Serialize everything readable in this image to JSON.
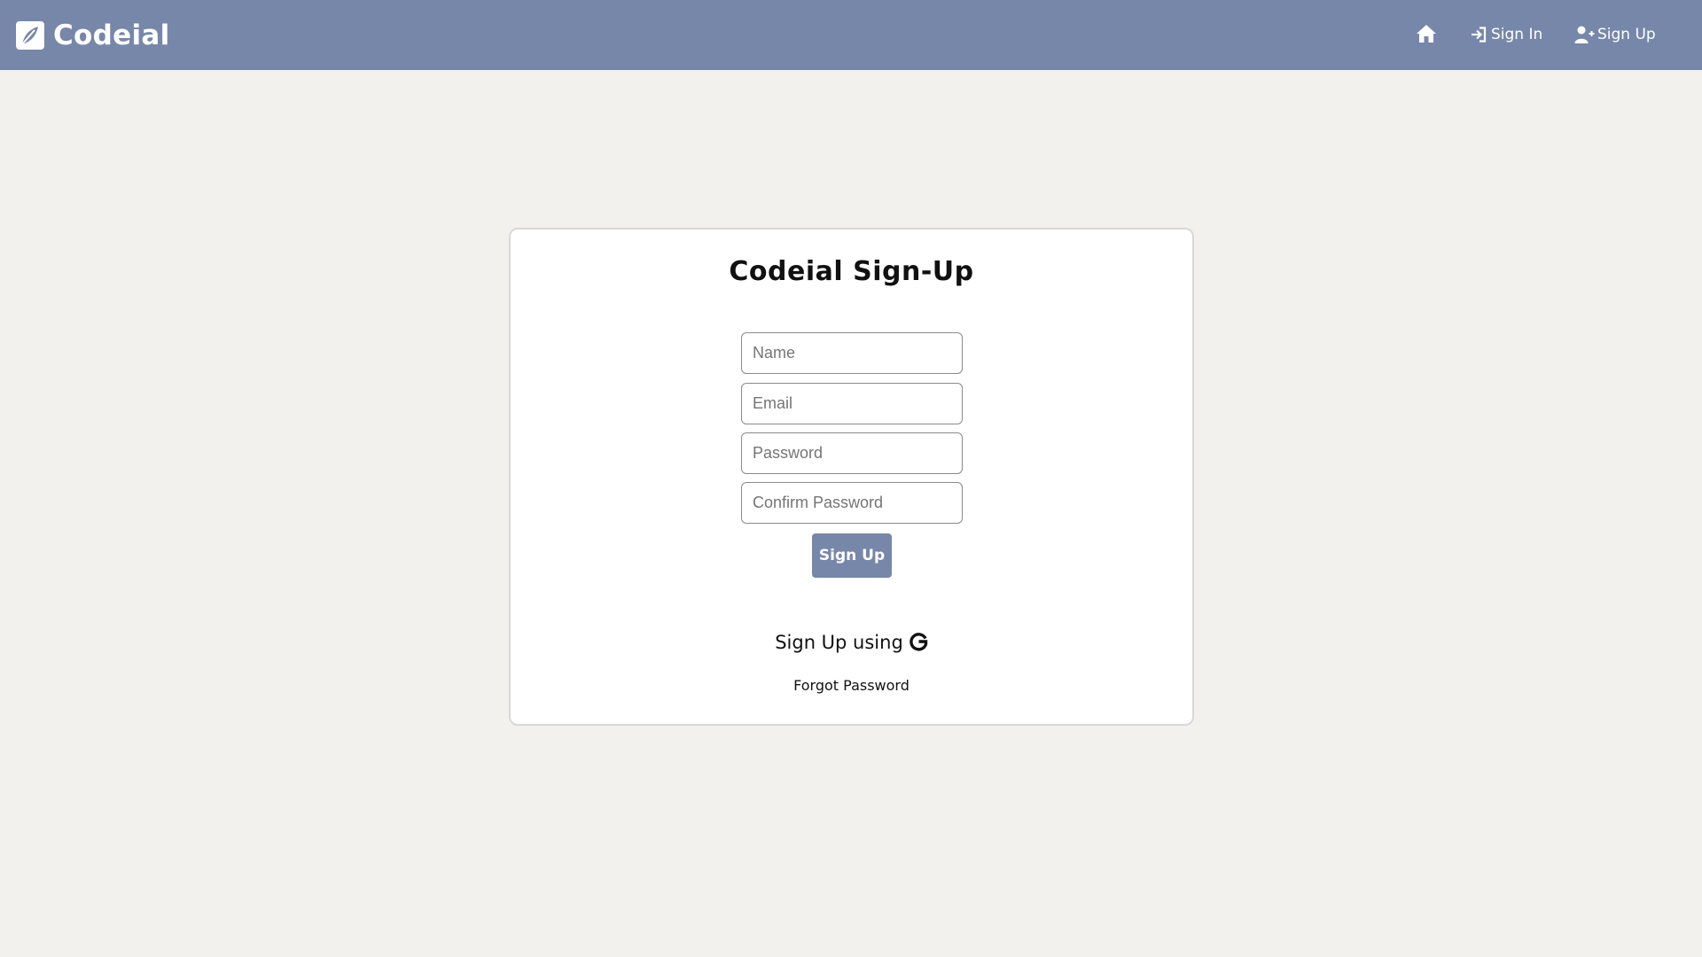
{
  "navbar": {
    "brand": "Codeial",
    "brand_icon": "leaf-icon",
    "home_icon": "home-icon",
    "signin_icon": "sign-in-icon",
    "signin_label": "Sign In",
    "signup_icon": "user-plus-icon",
    "signup_label": "Sign Up",
    "bg_color": "#7787a9"
  },
  "form": {
    "title": "Codeial Sign-Up",
    "name_placeholder": "Name",
    "email_placeholder": "Email",
    "password_placeholder": "Password",
    "confirm_placeholder": "Confirm Password",
    "submit_label": "Sign Up",
    "google_label": "Sign Up using",
    "google_icon": "google-icon",
    "forgot_label": "Forgot Password"
  },
  "colors": {
    "page_bg": "#f2f1ed",
    "accent": "#7787a9"
  }
}
